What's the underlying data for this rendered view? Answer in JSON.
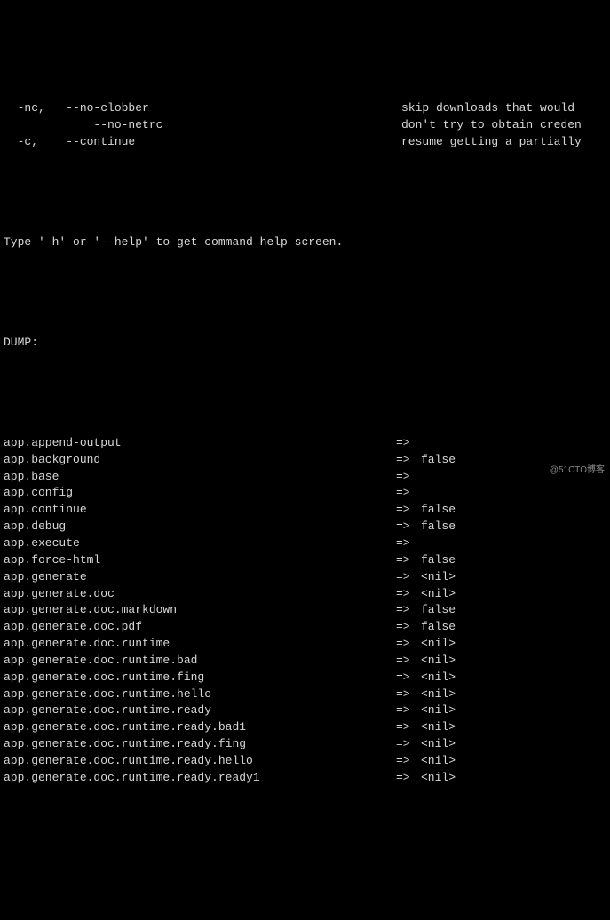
{
  "options": [
    {
      "short": "-nc,",
      "long": "--no-clobber",
      "desc": "skip downloads that would"
    },
    {
      "short": "",
      "long": "    --no-netrc",
      "desc": "don't try to obtain creden"
    },
    {
      "short": "-c,",
      "long": "--continue",
      "desc": "resume getting a partially"
    }
  ],
  "help_line": "Type '-h' or '--help' to get command help screen.",
  "dump_header": "DUMP:",
  "arrow": "=>",
  "dump": [
    {
      "key": "app.append-output",
      "val": ""
    },
    {
      "key": "app.background",
      "val": "false"
    },
    {
      "key": "app.base",
      "val": ""
    },
    {
      "key": "app.config",
      "val": ""
    },
    {
      "key": "app.continue",
      "val": "false"
    },
    {
      "key": "app.debug",
      "val": "false"
    },
    {
      "key": "app.execute",
      "val": ""
    },
    {
      "key": "app.force-html",
      "val": "false"
    },
    {
      "key": "app.generate",
      "val": "<nil>"
    },
    {
      "key": "app.generate.doc",
      "val": "<nil>"
    },
    {
      "key": "app.generate.doc.markdown",
      "val": "false"
    },
    {
      "key": "app.generate.doc.pdf",
      "val": "false"
    },
    {
      "key": "app.generate.doc.runtime",
      "val": "<nil>"
    },
    {
      "key": "app.generate.doc.runtime.bad",
      "val": "<nil>"
    },
    {
      "key": "app.generate.doc.runtime.fing",
      "val": "<nil>"
    },
    {
      "key": "app.generate.doc.runtime.hello",
      "val": "<nil>"
    },
    {
      "key": "app.generate.doc.runtime.ready",
      "val": "<nil>"
    },
    {
      "key": "app.generate.doc.runtime.ready.bad1",
      "val": "<nil>"
    },
    {
      "key": "app.generate.doc.runtime.ready.fing",
      "val": "<nil>"
    },
    {
      "key": "app.generate.doc.runtime.ready.hello",
      "val": "<nil>"
    },
    {
      "key": "app.generate.doc.runtime.ready.ready1",
      "val": "<nil>"
    }
  ],
  "watermark": "@51CTO博客"
}
